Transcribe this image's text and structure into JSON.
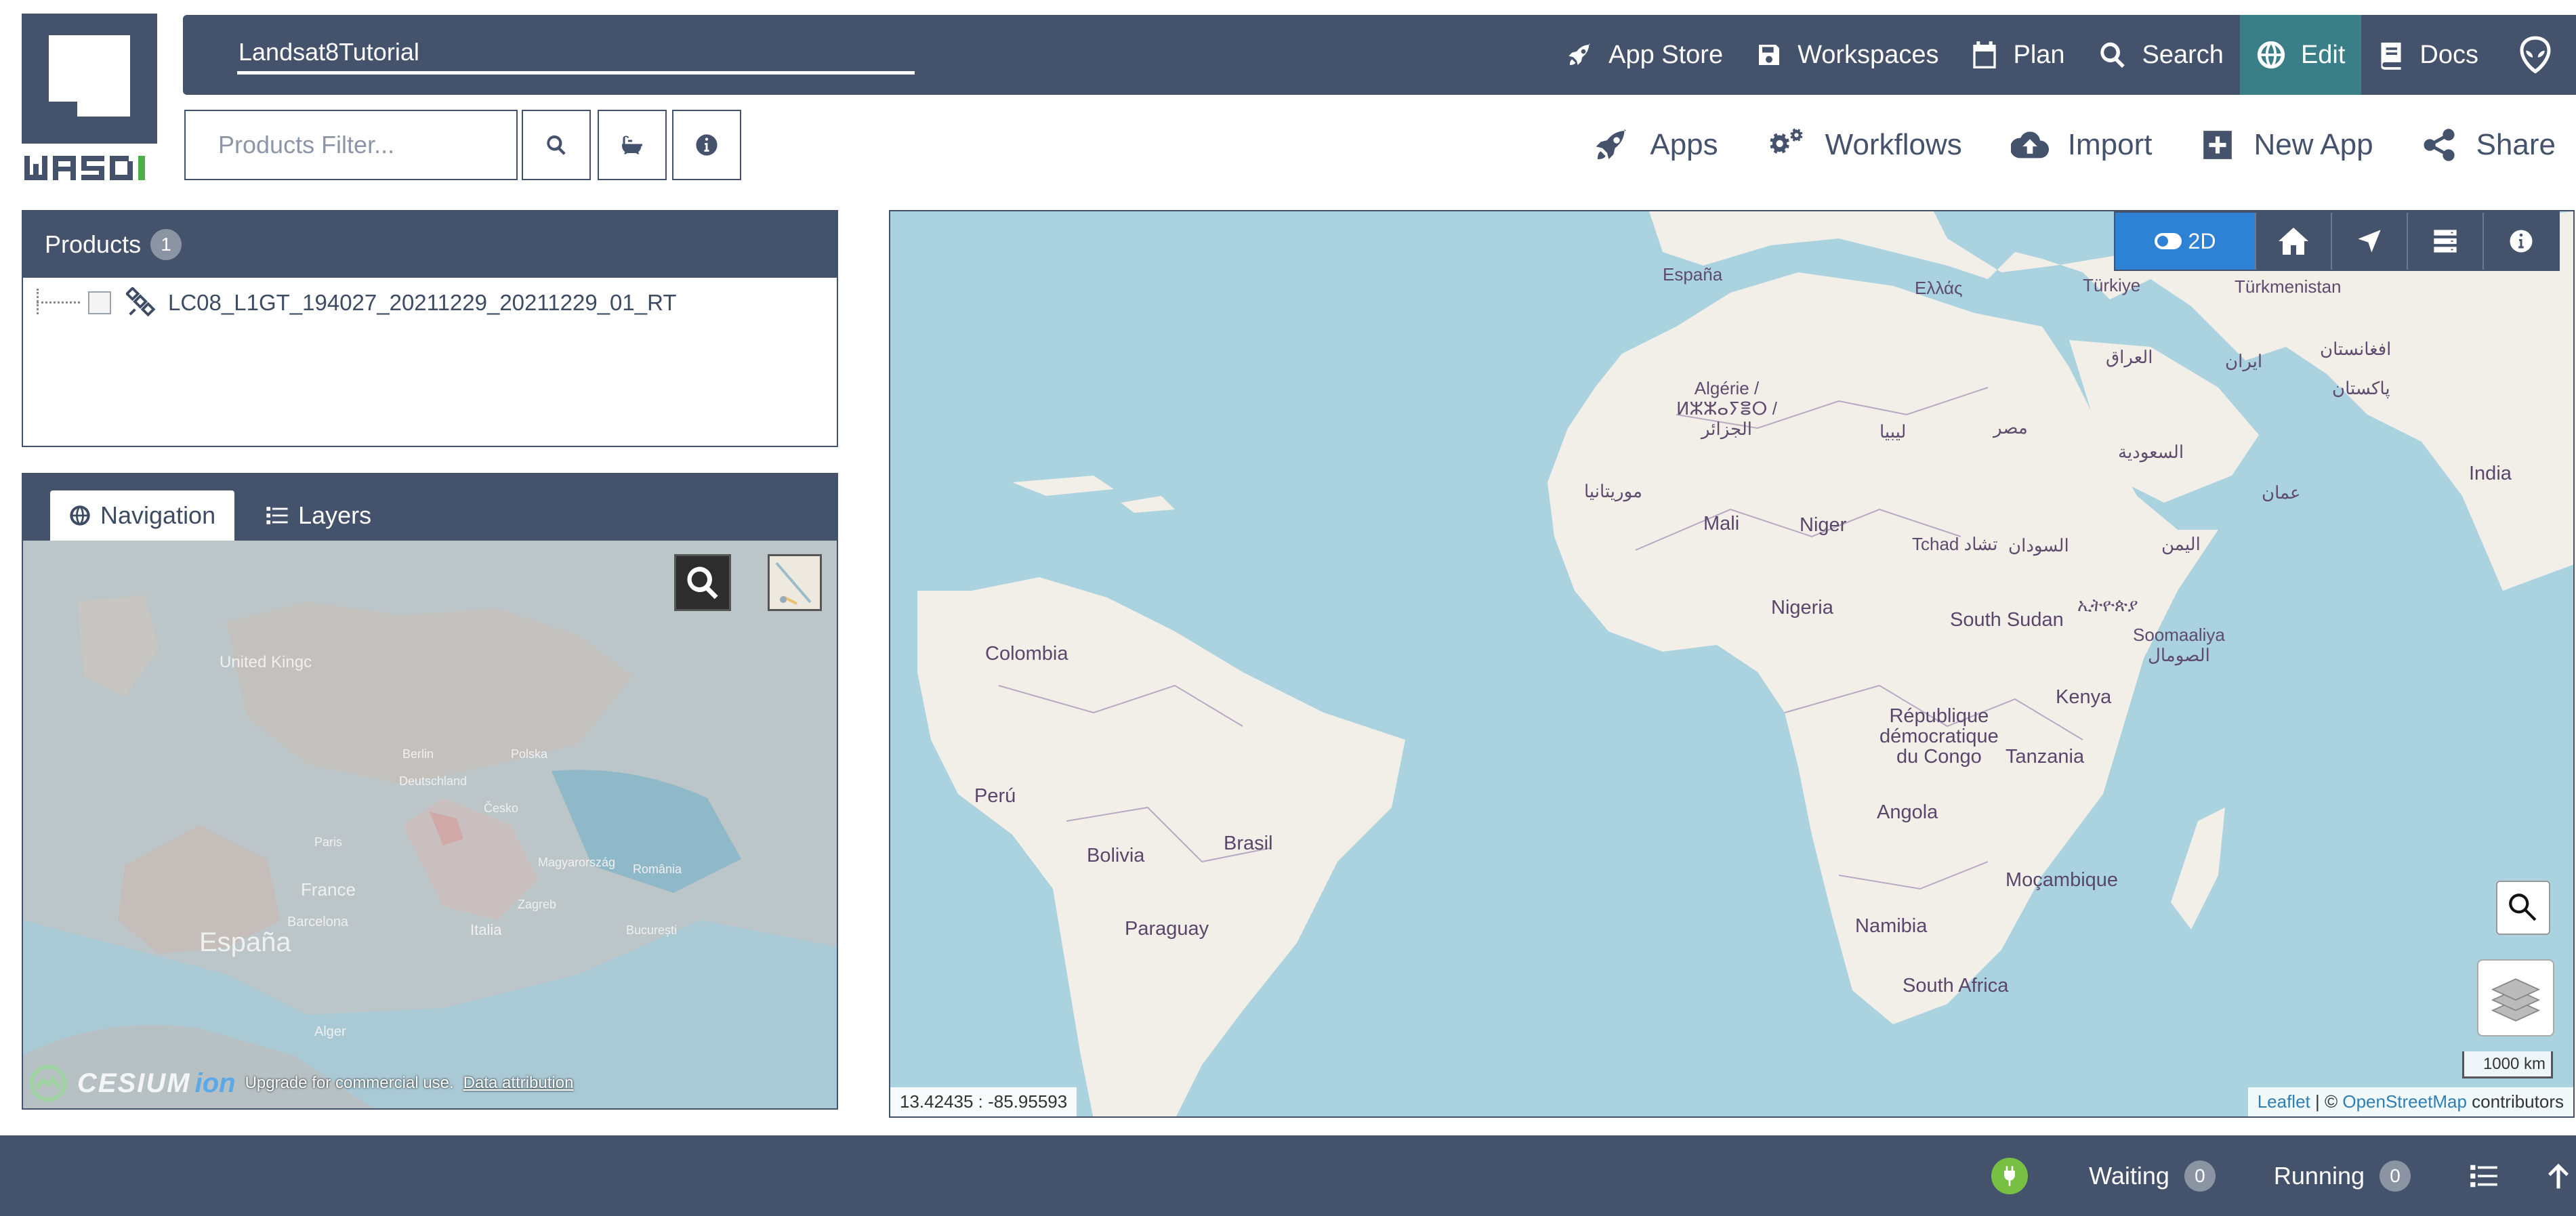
{
  "app": {
    "logo_text": "WASDI"
  },
  "workspace": {
    "name": "Landsat8Tutorial"
  },
  "topnav": [
    {
      "label": "App Store",
      "icon": "rocket-icon"
    },
    {
      "label": "Workspaces",
      "icon": "floppy-icon"
    },
    {
      "label": "Plan",
      "icon": "calendar-icon"
    },
    {
      "label": "Search",
      "icon": "search-icon"
    },
    {
      "label": "Edit",
      "icon": "globe-icon",
      "active": true
    },
    {
      "label": "Docs",
      "icon": "book-icon"
    }
  ],
  "filter": {
    "placeholder": "Products Filter..."
  },
  "actions": [
    {
      "label": "Apps",
      "icon": "rocket-icon"
    },
    {
      "label": "Workflows",
      "icon": "gears-icon"
    },
    {
      "label": "Import",
      "icon": "cloud-upload-icon"
    },
    {
      "label": "New App",
      "icon": "plus-square-icon"
    },
    {
      "label": "Share",
      "icon": "share-icon"
    }
  ],
  "products": {
    "title": "Products",
    "count": "1",
    "items": [
      {
        "name": "LC08_L1GT_194027_20211229_20211229_01_RT"
      }
    ]
  },
  "navigation": {
    "tabs": [
      {
        "label": "Navigation",
        "icon": "globe-icon",
        "active": true
      },
      {
        "label": "Layers",
        "icon": "list-icon",
        "active": false
      }
    ],
    "globe_labels": {
      "united_kingdom": "United Kingc",
      "france": "France",
      "espana": "España",
      "barcelona": "Barcelona",
      "italia": "Italia",
      "deutschland": "Deutschland",
      "paris": "Paris",
      "berlin": "Berlin",
      "polska": "Polska",
      "cesko": "Česko",
      "magyarorszag": "Magyarország",
      "romania": "România",
      "zagreb": "Zagreb",
      "bucuresti": "București",
      "alger": "Alger"
    },
    "cesium_brand": "CESIUM",
    "cesium_ion": "ion",
    "cesium_upgrade": "Upgrade for commercial use.",
    "cesium_attribution": "Data attribution"
  },
  "map": {
    "mode_label": "2D",
    "coords": "13.42435 : -85.95593",
    "scale": "1000 km",
    "attribution_leaflet": "Leaflet",
    "attribution_sep": " | © ",
    "attribution_osm": "OpenStreetMap",
    "attribution_tail": " contributors",
    "labels": {
      "espana": "España",
      "ellas": "Ελλάς",
      "turkiye": "Türkiye",
      "turkmenistan": "Türkmenistan",
      "algerie": "Algérie /\nⵍⵣⵣⴰⵢⴻⵔ /\nالجزائر",
      "libya": "ليبيا",
      "misr": "مصر",
      "iraq": "العراق",
      "iran": "ایران",
      "afghanistan": "افغانستان",
      "pakistan": "پاکستان",
      "saudi": "السعودية",
      "oman": "عمان",
      "india": "India",
      "mauritania": "موريتانيا",
      "mali": "Mali",
      "niger": "Niger",
      "tchad": "Tchad تشاد",
      "sudan": "السودان",
      "yemen": "اليمن",
      "nigeria": "Nigeria",
      "south_sudan": "South Sudan",
      "ethiopia": "ኢትዮጵያ",
      "somalia": "Soomaaliya\nالصومال",
      "colombia": "Colombia",
      "kenya": "Kenya",
      "rdc": "République\ndémocratique\ndu Congo",
      "tanzania": "Tanzania",
      "peru": "Perú",
      "brasil": "Brasil",
      "bolivia": "Bolivia",
      "angola": "Angola",
      "mocambique": "Moçambique",
      "paraguay": "Paraguay",
      "namibia": "Namibia",
      "south_africa": "South Africa"
    }
  },
  "footer": {
    "waiting_label": "Waiting",
    "waiting_count": "0",
    "running_label": "Running",
    "running_count": "0"
  },
  "colors": {
    "header": "#45526c",
    "edit_active": "#3a7f88",
    "mode_2d": "#2e82d6",
    "ocean": "#aad3df",
    "land": "#f2efe9",
    "connection_ok": "#78c043"
  }
}
